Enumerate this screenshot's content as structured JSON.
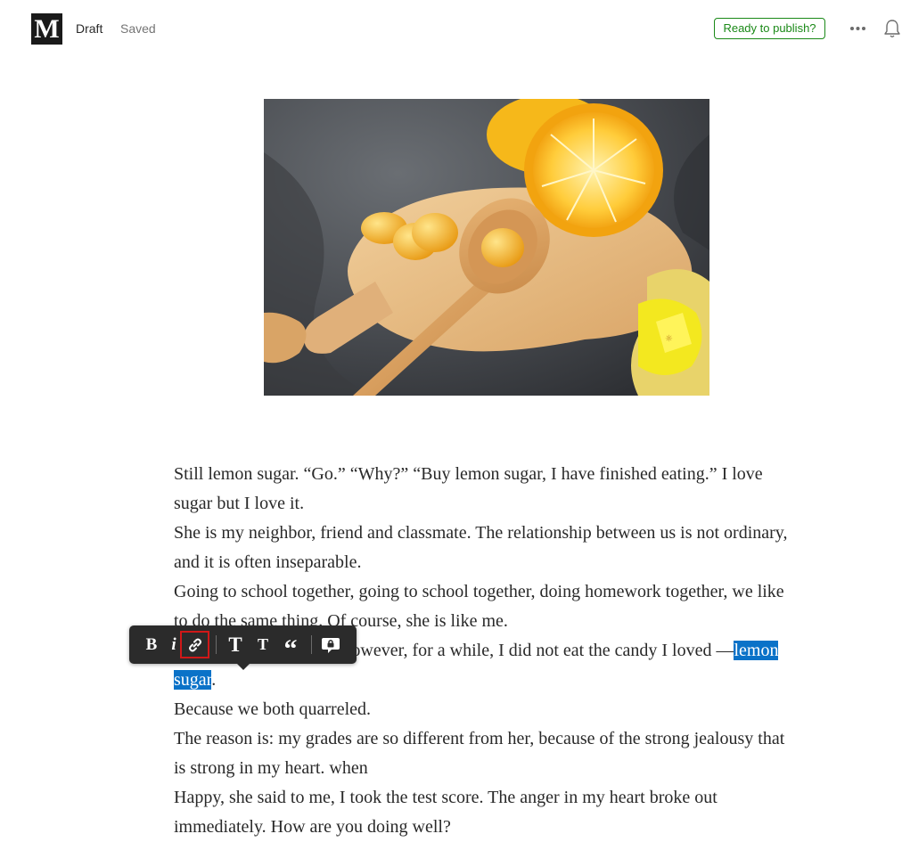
{
  "header": {
    "logo": "M",
    "status": "Draft",
    "save_state": "Saved",
    "publish_label": "Ready to publish?"
  },
  "hero_image": {
    "description_icon": "lemon-candy-photo-icon"
  },
  "toolbar": {
    "bold": "B",
    "italic": "i",
    "link_icon": "link-icon",
    "title_large": "T",
    "title_small": "T",
    "quote": "“",
    "private_note_icon": "private-note-icon"
  },
  "article": {
    "paragraphs": [
      "Still lemon sugar. “Go.” “Why?” “Buy lemon sugar, I have finished eating.” I love sugar but I love it.",
      "She is my neighbor, friend and classmate. The relationship between us is not ordinary, and it is often inseparable.",
      "Going to school together, going to school together, doing homework together, we like to do the same thing. Of course, she is like me.",
      "Because we both quarreled.",
      "The reason is: my grades are so different from her, because of the strong jealousy that is strong in my heart. when",
      "Happy, she said to me, I took the test score. The anger in my heart broke out immediately. How are you doing well?"
    ],
    "p4_before": "She likes lemon sugar. However, for a while, I did not eat the candy I loved —",
    "p4_selected": "lemon sugar",
    "p4_after": "."
  },
  "colors": {
    "accent_green": "#1a8917",
    "selection_blue": "#0a72c8",
    "toolbar_bg": "#2b2b2b",
    "focus_red": "#d01818"
  }
}
